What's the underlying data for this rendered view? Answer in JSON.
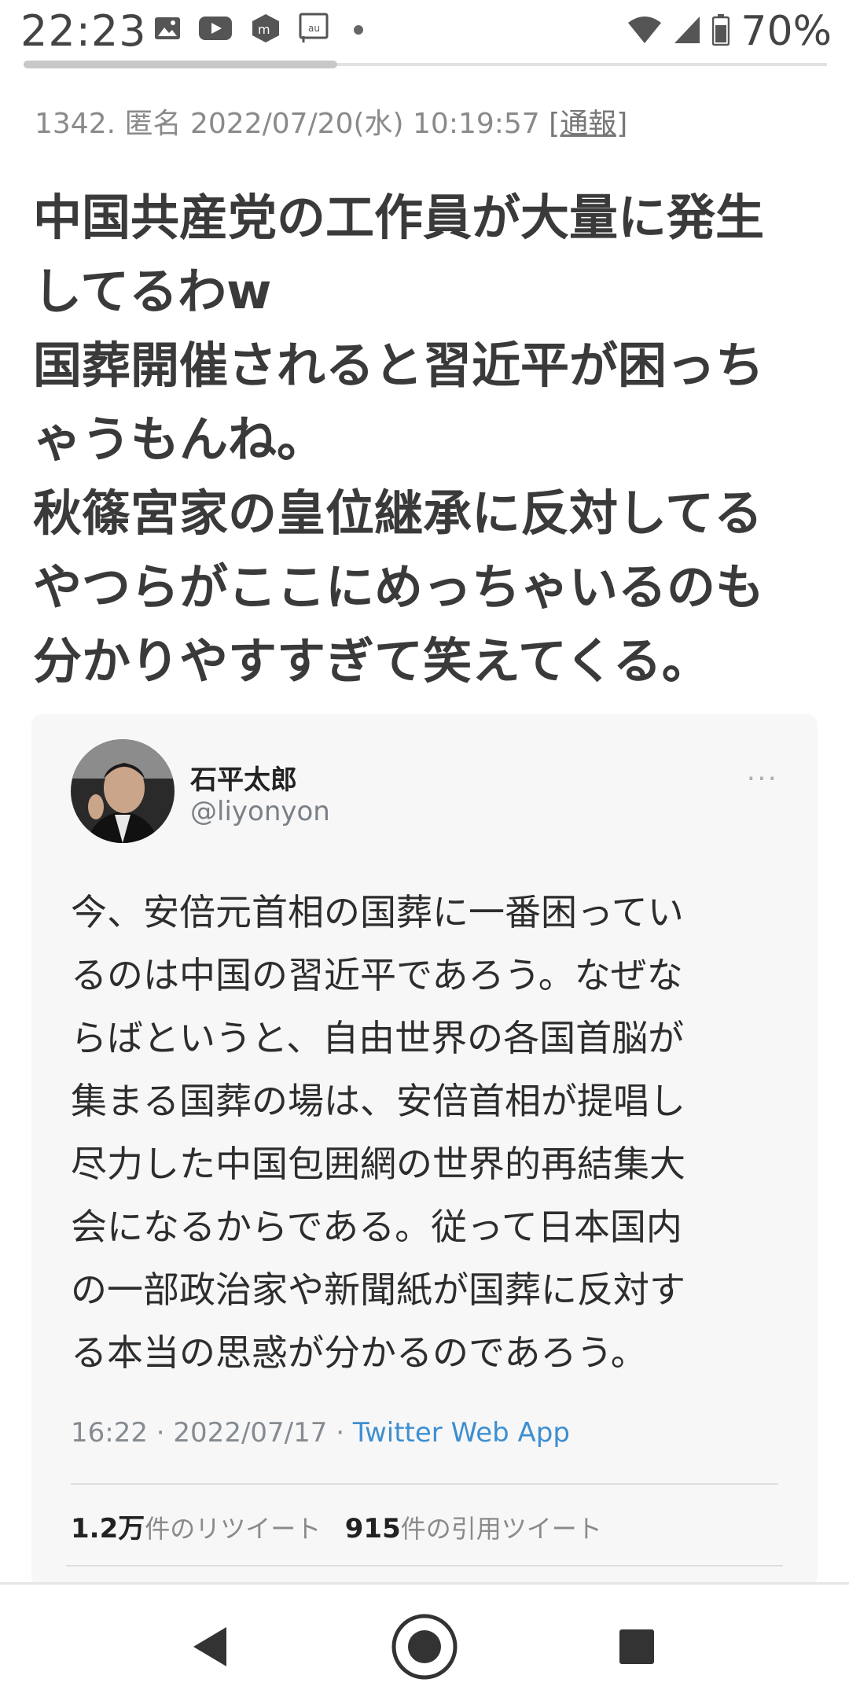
{
  "status_bar": {
    "time": "22:23",
    "battery_percent": "70%",
    "notification_icons": [
      "image-icon",
      "youtube-icon",
      "mercari-icon",
      "au-icon"
    ],
    "colors": {
      "icon": "#555555"
    }
  },
  "page_progress": 0.39,
  "post": {
    "number": "1342.",
    "author": "匿名",
    "datetime": "2022/07/20(水) 10:19:57",
    "report_label": "[通報]",
    "body_lines": [
      "中国共産党の工作員が大量に発生",
      "してるわw",
      "国葬開催されると習近平が困っち",
      "ゃうもんね。",
      "秋篠宮家の皇位継承に反対してる",
      "やつらがここにめっちゃいるのも",
      "分かりやすすぎて笑えてくる。"
    ]
  },
  "tweet": {
    "author_name": "石平太郎",
    "handle": "@liyonyon",
    "more_label": "···",
    "body_lines": [
      "今、安倍元首相の国葬に一番困ってい",
      "るのは中国の習近平であろう。なぜな",
      "らばというと、自由世界の各国首脳が",
      "集まる国葬の場は、安倍首相が提唱し",
      "尽力した中国包囲網の世界的再結集大",
      "会になるからである。従って日本国内",
      "の一部政治家や新聞紙が国葬に反対す",
      "る本当の思惑が分かるのであろう。"
    ],
    "time": "16:22",
    "separator": " · ",
    "date": "2022/07/17",
    "app": "Twitter Web App",
    "retweet_count": "1.2万",
    "retweet_label": "件のリツイート",
    "quote_count": "915",
    "quote_label": "件の引用ツイート",
    "colors": {
      "link": "#3e8fd0",
      "card_bg": "#f7f7f7"
    }
  },
  "nav": {
    "buttons": [
      "back-icon",
      "home-icon",
      "recents-icon"
    ],
    "colors": {
      "icon": "#333333"
    }
  }
}
